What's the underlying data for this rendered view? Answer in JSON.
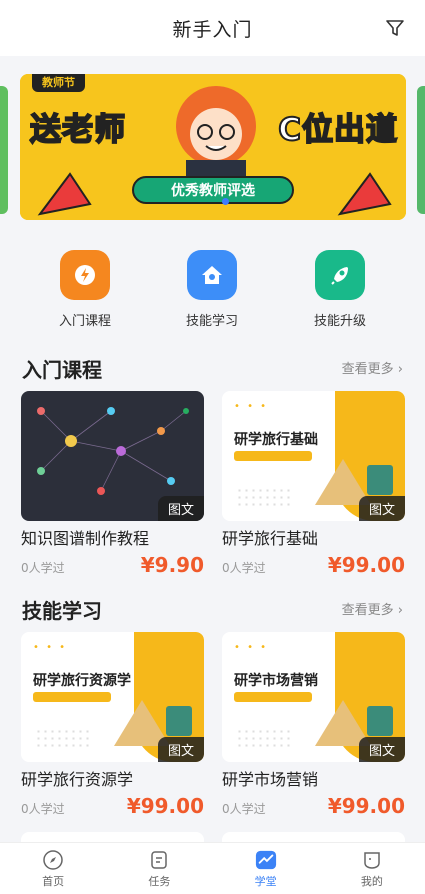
{
  "header": {
    "title": "新手入门"
  },
  "banner": {
    "tag": "教师节",
    "left_text": "送老师",
    "right_text": "C位出道",
    "pill": "优秀教师评选"
  },
  "quick": [
    {
      "label": "入门课程",
      "icon": "lightning-icon",
      "color": "#f5871f"
    },
    {
      "label": "技能学习",
      "icon": "house-icon",
      "color": "#3d8ef8"
    },
    {
      "label": "技能升级",
      "icon": "rocket-icon",
      "color": "#19b98a"
    }
  ],
  "sections": {
    "intro": {
      "title": "入门课程",
      "more": "查看更多",
      "cards": [
        {
          "name": "知识图谱制作教程",
          "learned": "0人学过",
          "price": "¥9.90",
          "badge": "图文"
        },
        {
          "name": "研学旅行基础",
          "learned": "0人学过",
          "price": "¥99.00",
          "badge": "图文",
          "thumb_title": "研学旅行基础"
        }
      ]
    },
    "skills": {
      "title": "技能学习",
      "more": "查看更多",
      "cards": [
        {
          "name": "研学旅行资源学",
          "learned": "0人学过",
          "price": "¥99.00",
          "badge": "图文",
          "thumb_title": "研学旅行资源学"
        },
        {
          "name": "研学市场营销",
          "learned": "0人学过",
          "price": "¥99.00",
          "badge": "图文",
          "thumb_title": "研学市场营销"
        }
      ]
    }
  },
  "tabbar": [
    {
      "label": "首页",
      "icon": "compass-icon",
      "active": false
    },
    {
      "label": "任务",
      "icon": "task-icon",
      "active": false
    },
    {
      "label": "学堂",
      "icon": "chart-icon",
      "active": true
    },
    {
      "label": "我的",
      "icon": "profile-icon",
      "active": false
    }
  ],
  "colors": {
    "accent": "#3b82f6",
    "price": "#f05a2b",
    "banner": "#f7c51d"
  }
}
